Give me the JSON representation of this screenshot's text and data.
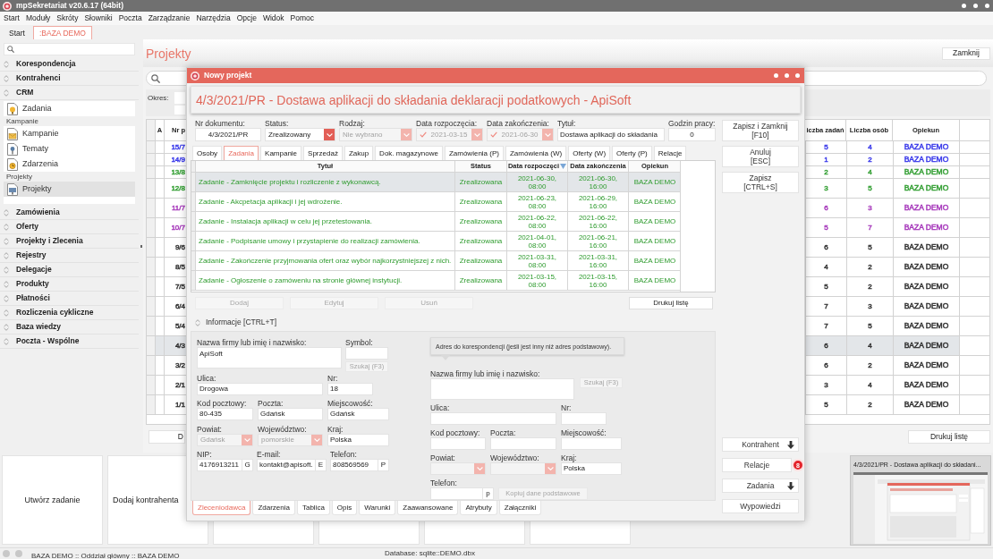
{
  "window": {
    "title": "mpSekretariat v20.6.17 (64bit)"
  },
  "menu": [
    "Start",
    "Moduły",
    "Skróty",
    "Słowniki",
    "Poczta",
    "Zarządzanie",
    "Narzędzia",
    "Opcje",
    "Widok",
    "Pomoc"
  ],
  "tabs": [
    {
      "label": "Start",
      "selected": false
    },
    {
      "label": ":BAZA DEMO",
      "selected": true
    }
  ],
  "sidebar": {
    "sections": [
      {
        "label": "Korespondencja"
      },
      {
        "label": "Kontrahenci"
      },
      {
        "label": "CRM",
        "groups": [
          {
            "items": [
              {
                "label": "Zadania",
                "selected": false
              }
            ]
          },
          {
            "title": "Kampanie",
            "items": [
              {
                "label": "Kampanie",
                "selected": false
              },
              {
                "label": "Tematy",
                "selected": false
              },
              {
                "label": "Zdarzenia",
                "selected": false
              }
            ]
          },
          {
            "title": "Projekty",
            "items": [
              {
                "label": "Projekty",
                "selected": true
              }
            ]
          }
        ]
      },
      {
        "label": "Zamówienia"
      },
      {
        "label": "Oferty"
      },
      {
        "label": "Projekty i Zlecenia"
      },
      {
        "label": "Rejestry"
      },
      {
        "label": "Delegacje"
      },
      {
        "label": "Produkty"
      },
      {
        "label": "Płatności"
      },
      {
        "label": "Rozliczenia cykliczne"
      },
      {
        "label": "Baza wiedzy"
      },
      {
        "label": "Poczta - Wspólne"
      }
    ]
  },
  "page": {
    "title": "Projekty",
    "close_button": "Zamknij",
    "period_label": "Okres:",
    "table": {
      "columns_left": [
        "A",
        "Nr p"
      ],
      "columns_right": [
        "iczba zadań",
        "Liczba osób",
        "Opiekun"
      ],
      "rows": [
        {
          "nr": "15/7",
          "tasks": "5",
          "people": "4",
          "owner": "BAZA DEMO",
          "color": "#3b3bea",
          "selected": false
        },
        {
          "nr": "14/9",
          "tasks": "1",
          "people": "2",
          "owner": "BAZA DEMO",
          "color": "#3b3bea",
          "selected": false
        },
        {
          "nr": "13/8",
          "tasks": "2",
          "people": "4",
          "owner": "BAZA DEMO",
          "color": "#36a036",
          "selected": false
        },
        {
          "nr": "12/8",
          "tasks": "3",
          "people": "5",
          "owner": "BAZA DEMO",
          "color": "#36a036",
          "selected": false
        },
        {
          "nr": "11/7",
          "tasks": "6",
          "people": "3",
          "owner": "BAZA DEMO",
          "color": "#a83cbc",
          "selected": false
        },
        {
          "nr": "10/7",
          "tasks": "5",
          "people": "7",
          "owner": "BAZA DEMO",
          "color": "#a83cbc",
          "selected": false
        },
        {
          "nr": "9/6",
          "tasks": "6",
          "people": "5",
          "owner": "BAZA DEMO",
          "color": "#333333",
          "selected": false
        },
        {
          "nr": "8/5",
          "tasks": "4",
          "people": "2",
          "owner": "BAZA DEMO",
          "color": "#333333",
          "selected": false
        },
        {
          "nr": "7/5",
          "tasks": "5",
          "people": "2",
          "owner": "BAZA DEMO",
          "color": "#333333",
          "selected": false
        },
        {
          "nr": "6/4",
          "tasks": "7",
          "people": "3",
          "owner": "BAZA DEMO",
          "color": "#333333",
          "selected": false
        },
        {
          "nr": "5/4",
          "tasks": "7",
          "people": "5",
          "owner": "BAZA DEMO",
          "color": "#333333",
          "selected": false
        },
        {
          "nr": "4/3",
          "tasks": "6",
          "people": "4",
          "owner": "BAZA DEMO",
          "color": "#333333",
          "selected": true
        },
        {
          "nr": "3/2",
          "tasks": "6",
          "people": "2",
          "owner": "BAZA DEMO",
          "color": "#333333",
          "selected": false
        },
        {
          "nr": "2/1",
          "tasks": "3",
          "people": "4",
          "owner": "BAZA DEMO",
          "color": "#333333",
          "selected": false
        },
        {
          "nr": "1/1",
          "tasks": "5",
          "people": "2",
          "owner": "BAZA DEMO",
          "color": "#333333",
          "selected": false
        }
      ]
    },
    "left_button": "D",
    "print_button": "Drukuj listę"
  },
  "dialog": {
    "title": "Nowy projekt",
    "heading": "4/3/2021/PR - Dostawa aplikacji do składania deklaracji podatkowych - ApiSoft",
    "fields": [
      {
        "kind": "text",
        "label": "Nr dokumentu:",
        "value": "4/3/2021/PR"
      },
      {
        "kind": "select",
        "label": "Status:",
        "value": "Zrealizowany",
        "disabled": false
      },
      {
        "kind": "select",
        "label": "Rodzaj:",
        "value": "Nie wybrano",
        "disabled": true
      },
      {
        "kind": "date",
        "label": "Data rozpoczęcia:",
        "value": "2021-03-15",
        "checked": true,
        "disabled": true
      },
      {
        "kind": "date",
        "label": "Data zakończenia:",
        "value": "2021-06-30",
        "checked": true,
        "disabled": true
      },
      {
        "kind": "text",
        "label": "Tytuł:",
        "value": "Dostawa aplikacji do składania"
      },
      {
        "kind": "text",
        "label": "Godzin pracy:",
        "value": "0"
      }
    ],
    "actions": [
      {
        "label": "Zapisz i Zamknij",
        "shortcut": "[F10]"
      },
      {
        "label": "Anuluj",
        "shortcut": "[ESC]"
      },
      {
        "label": "Zapisz",
        "shortcut": "[CTRL+S]"
      }
    ],
    "tabs": [
      {
        "label": "Osoby",
        "selected": false
      },
      {
        "label": "Zadania",
        "selected": true
      },
      {
        "label": "Kampanie",
        "selected": false
      },
      {
        "label": "Sprzedaż",
        "selected": false
      },
      {
        "label": "Zakup",
        "selected": false
      },
      {
        "label": "Dok. magazynowe",
        "selected": false
      },
      {
        "label": "Zamówienia (P)",
        "selected": false
      },
      {
        "label": "Zamówienia (W)",
        "selected": false
      },
      {
        "label": "Oferty (W)",
        "selected": false
      },
      {
        "label": "Oferty (P)",
        "selected": false
      },
      {
        "label": "Relacje",
        "selected": false
      }
    ],
    "tasks": {
      "columns": [
        {
          "label": "Tytuł",
          "sorted": false
        },
        {
          "label": "Status",
          "sorted": false
        },
        {
          "label": "Data rozpoczęci",
          "sorted": true
        },
        {
          "label": "Data zakończenia",
          "sorted": false
        },
        {
          "label": "Opiekun",
          "sorted": false
        }
      ],
      "rows": [
        {
          "title": "Zadanie - Zamknięcie projektu i rozliczenie z wykonawcą.",
          "status": "Zrealizowana",
          "start": "2021-06-30, 08:00",
          "end": "2021-06-30, 16:00",
          "owner": "BAZA DEMO",
          "selected": true
        },
        {
          "title": "Zadanie - Akcpetacja aplikacji i jej wdrożenie.",
          "status": "Zrealizowana",
          "start": "2021-06-23, 08:00",
          "end": "2021-06-29, 16:00",
          "owner": "BAZA DEMO",
          "selected": false
        },
        {
          "title": "Zadanie - Instalacja aplikacji w celu jej przetestowania.",
          "status": "Zrealizowana",
          "start": "2021-06-22, 08:00",
          "end": "2021-06-22, 16:00",
          "owner": "BAZA DEMO",
          "selected": false
        },
        {
          "title": "Zadanie - Podpisanie umowy i przystapienie do realizacji zamówienia.",
          "status": "Zrealizowana",
          "start": "2021-04-01, 08:00",
          "end": "2021-06-21, 16:00",
          "owner": "BAZA DEMO",
          "selected": false
        },
        {
          "title": "Zadanie - Zakończenie przyjmowania ofert oraz wybór najkorzystniejszej z nich.",
          "status": "Zrealizowana",
          "start": "2021-03-31, 08:00",
          "end": "2021-03-31, 16:00",
          "owner": "BAZA DEMO",
          "selected": false
        },
        {
          "title": "Zadanie - Ogłoszenie o zamóweniu na stronie głównej instytucji.",
          "status": "Zrealizowana",
          "start": "2021-03-15, 08:00",
          "end": "2021-03-15, 16:00",
          "owner": "BAZA DEMO",
          "selected": false
        }
      ]
    },
    "task_buttons": [
      {
        "label": "Dodaj",
        "disabled": true
      },
      {
        "label": "Edytuj",
        "disabled": true
      },
      {
        "label": "Usuń",
        "disabled": true
      },
      {
        "label": "Drukuj listę",
        "disabled": false
      }
    ],
    "info": {
      "title": "Informacje [CTRL+T]",
      "client": {
        "name": {
          "label": "Nazwa firmy lub imię i nazwisko:",
          "value": "ApiSoft"
        },
        "symbol": {
          "label": "Symbol:"
        },
        "search": {
          "label": "Szukaj (F3)",
          "disabled": true
        },
        "street": {
          "label": "Ulica:",
          "value": "Drogowa"
        },
        "number": {
          "label": "Nr:",
          "value": "18"
        },
        "postal_code": {
          "label": "Kod pocztowy:",
          "value": "80-435"
        },
        "post_office": {
          "label": "Poczta:",
          "value": "Gdańsk"
        },
        "city": {
          "label": "Miejscowość:",
          "value": "Gdańsk"
        },
        "county": {
          "label": "Powiat:",
          "value": "Gdańsk",
          "disabled": true
        },
        "province": {
          "label": "Województwo:",
          "value": "pomorskie",
          "disabled": true
        },
        "country": {
          "label": "Kraj:",
          "value": "Polska"
        },
        "nip": {
          "label": "NIP:",
          "value": "4176913211",
          "button": "G"
        },
        "email": {
          "label": "E-mail:",
          "value": "kontakt@apisoft.",
          "button": "E"
        },
        "phone": {
          "label": "Telefon:",
          "value": "808569569",
          "button": "P"
        }
      },
      "correspondence": {
        "note": "Adres do korespondencji (jeśli jest inny niż adres podstawowy).",
        "name": {
          "label": "Nazwa firmy lub imię i nazwisko:"
        },
        "search": {
          "label": "Szukaj (F3)",
          "disabled": true
        },
        "street": {
          "label": "Ulica:"
        },
        "number": {
          "label": "Nr:"
        },
        "postal_code": {
          "label": "Kod pocztowy:"
        },
        "post_office": {
          "label": "Poczta:"
        },
        "city": {
          "label": "Miejscowość:"
        },
        "county": {
          "label": "Powiat:",
          "disabled": true
        },
        "province": {
          "label": "Województwo:",
          "disabled": true
        },
        "country": {
          "label": "Kraj:",
          "value": "Polska"
        },
        "phone": {
          "label": "Telefon:",
          "button": "p"
        },
        "copy": {
          "label": "Kopiuj dane podstawowe",
          "disabled": true
        }
      }
    },
    "bottom_tabs": [
      {
        "label": "Zleceniodawca",
        "selected": true
      },
      {
        "label": "Zdarzenia",
        "selected": false
      },
      {
        "label": "Tablica",
        "selected": false
      },
      {
        "label": "Opis",
        "selected": false
      },
      {
        "label": "Warunki",
        "selected": false
      },
      {
        "label": "Zaawansowane",
        "selected": false
      },
      {
        "label": "Atrybuty",
        "selected": false
      },
      {
        "label": "Załączniki",
        "selected": false
      }
    ],
    "side_buttons": [
      {
        "label": "Kontrahent",
        "kind": "dropdown"
      },
      {
        "label": "Relacje",
        "kind": "plain",
        "badge": "8"
      },
      {
        "label": "Zadania",
        "kind": "dropdown"
      },
      {
        "label": "Wypowiedzi",
        "kind": "plain"
      }
    ]
  },
  "tiles": [
    "Utwórz zadanie",
    "Dodaj kontrahenta"
  ],
  "preview": {
    "title": "4/3/2021/PR - Dostawa aplikacji do składani..."
  },
  "status_bar": {
    "session": "BAZA DEMO :: Oddział główny :: BAZA DEMO",
    "database": "Database: sqlite::DEMO.dbx"
  }
}
